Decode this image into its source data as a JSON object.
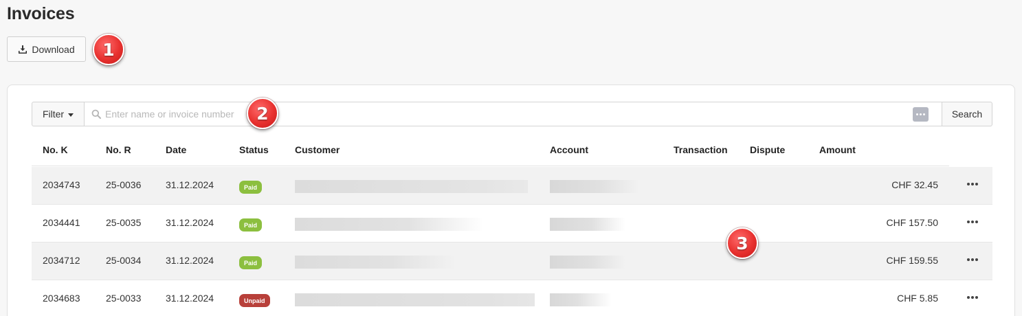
{
  "page": {
    "title": "Invoices"
  },
  "toolbar": {
    "download_label": "Download",
    "download_icon": "download-icon"
  },
  "markers": [
    "1",
    "2",
    "3"
  ],
  "search": {
    "filter_label": "Filter",
    "placeholder": "Enter name or invoice number",
    "value": "",
    "button_label": "Search"
  },
  "table": {
    "columns": [
      "No. K",
      "No. R",
      "Date",
      "Status",
      "Customer",
      "Account",
      "Transaction",
      "Dispute",
      "Amount"
    ],
    "rows": [
      {
        "no_k": "2034743",
        "no_r": "25-0036",
        "date": "31.12.2024",
        "status": "Paid",
        "amount": "CHF 32.45"
      },
      {
        "no_k": "2034441",
        "no_r": "25-0035",
        "date": "31.12.2024",
        "status": "Paid",
        "amount": "CHF 157.50"
      },
      {
        "no_k": "2034712",
        "no_r": "25-0034",
        "date": "31.12.2024",
        "status": "Paid",
        "amount": "CHF 159.55"
      },
      {
        "no_k": "2034683",
        "no_r": "25-0033",
        "date": "31.12.2024",
        "status": "Unpaid",
        "amount": "CHF 5.85"
      }
    ]
  },
  "colors": {
    "paid": "#8cbf3f",
    "unpaid": "#b8403a",
    "marker": "#e8312f"
  }
}
